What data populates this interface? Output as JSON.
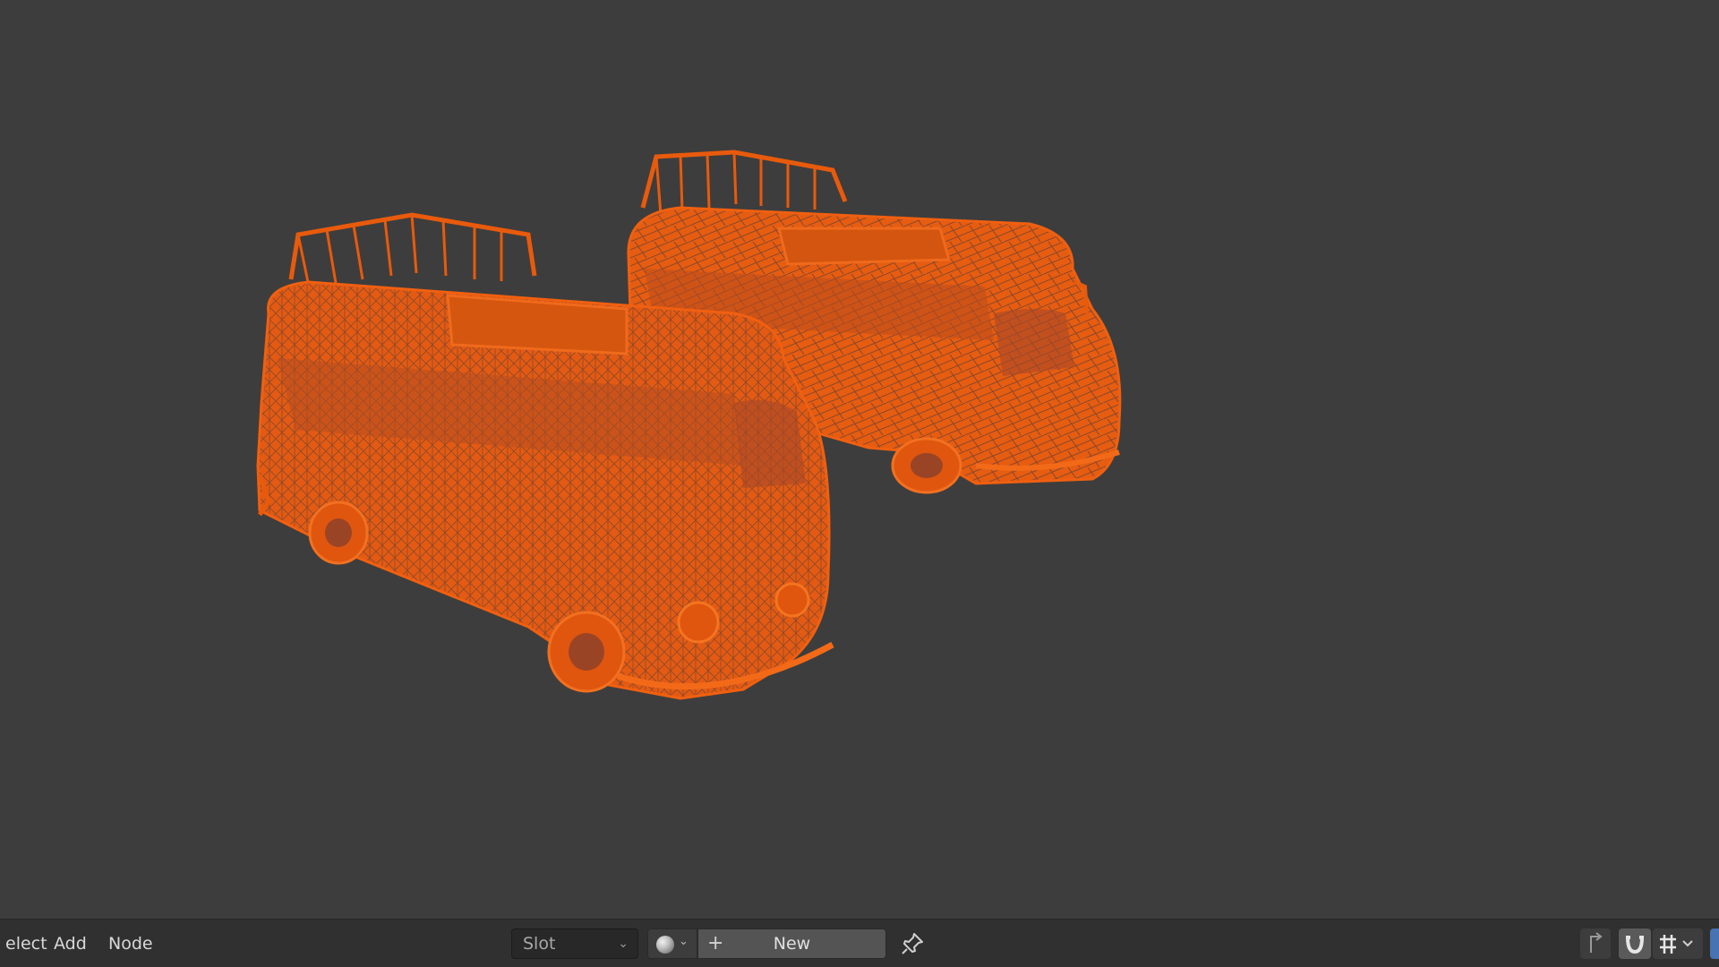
{
  "header_menu": {
    "select": "elect",
    "add": "Add",
    "node": "Node"
  },
  "material": {
    "slot_label": "Slot",
    "new_label": "New",
    "browse_icon": "material-sphere-icon",
    "pin_icon": "pin-icon"
  },
  "right_tools": {
    "parent_icon": "parent-arrow-icon",
    "snap_icon": "snap-magnet-icon",
    "snap_mode_icon": "snap-increment-icon"
  },
  "colors": {
    "viewport_bg": "#3d3d3d",
    "header_bg": "#303030",
    "wireframe": "#e85a0c",
    "accent_blue": "#4772b3"
  },
  "scene": {
    "objects": [
      "van-front",
      "van-back"
    ]
  }
}
